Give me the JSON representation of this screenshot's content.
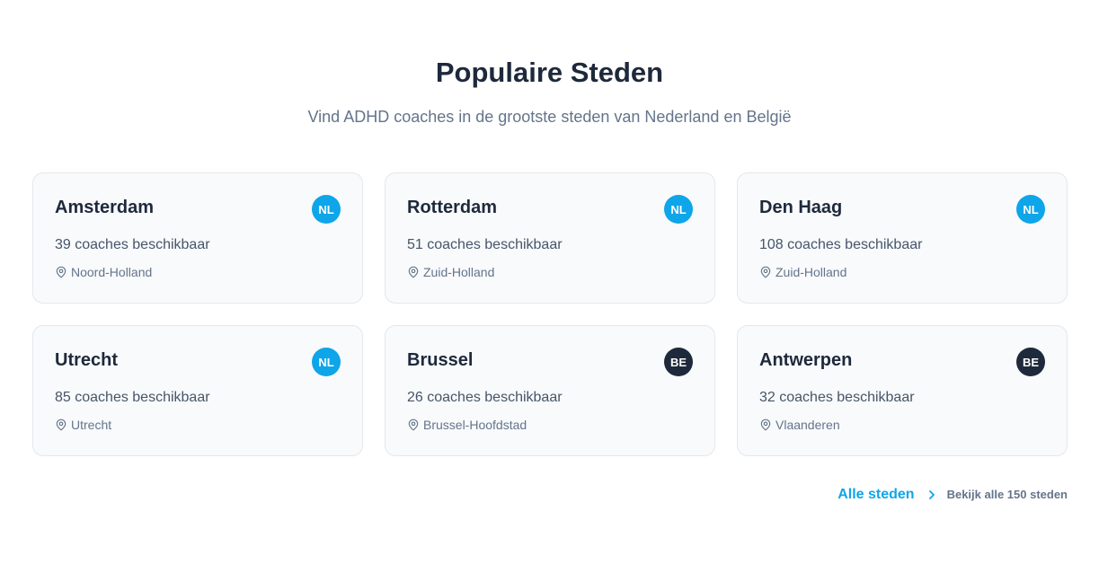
{
  "header": {
    "title": "Populaire Steden",
    "subtitle": "Vind ADHD coaches in de grootste steden van Nederland en België"
  },
  "cities": [
    {
      "name": "Amsterdam",
      "badge": "NL",
      "count": "39 coaches beschikbaar",
      "region": "Noord-Holland"
    },
    {
      "name": "Rotterdam",
      "badge": "NL",
      "count": "51 coaches beschikbaar",
      "region": "Zuid-Holland"
    },
    {
      "name": "Den Haag",
      "badge": "NL",
      "count": "108 coaches beschikbaar",
      "region": "Zuid-Holland"
    },
    {
      "name": "Utrecht",
      "badge": "NL",
      "count": "85 coaches beschikbaar",
      "region": "Utrecht"
    },
    {
      "name": "Brussel",
      "badge": "BE",
      "count": "26 coaches beschikbaar",
      "region": "Brussel-Hoofdstad"
    },
    {
      "name": "Antwerpen",
      "badge": "BE",
      "count": "32 coaches beschikbaar",
      "region": "Vlaanderen"
    }
  ],
  "footer": {
    "all_label": "Alle steden",
    "all_desc": "Bekijk alle 150 steden"
  },
  "icons": {
    "region": "map-pin-icon",
    "link": "chevron-right-icon"
  },
  "colors": {
    "accent": "#0ea5e9",
    "nl_badge": "#0ea5e9",
    "be_badge": "#1e293b",
    "heading": "#1e293b",
    "card_bg": "#f8fafc"
  }
}
